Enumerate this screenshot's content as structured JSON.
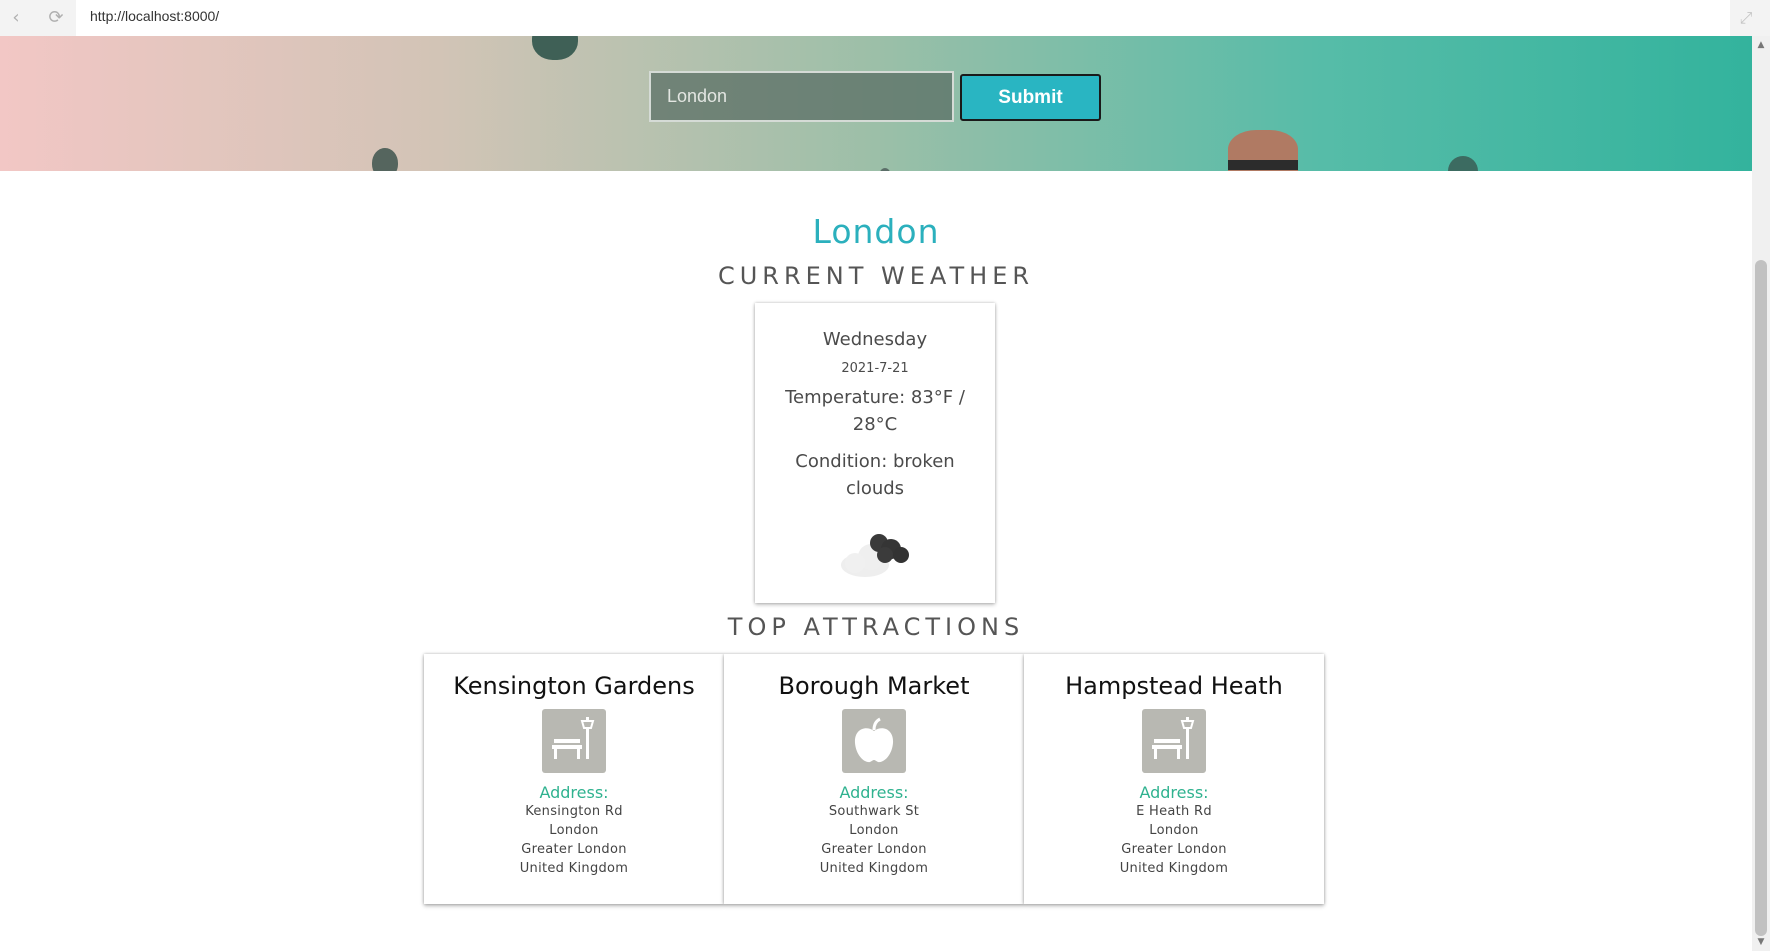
{
  "browser": {
    "url": "http://localhost:8000/",
    "back_icon": "back-arrow-icon",
    "reload_icon": "reload-icon",
    "expand_icon": "expand-icon"
  },
  "search": {
    "placeholder": "London",
    "submit_label": "Submit"
  },
  "weather": {
    "city": "London",
    "section_title": "CURRENT WEATHER",
    "day": "Wednesday",
    "date": "2021-7-21",
    "temperature": "Temperature: 83°F / 28°C",
    "condition": "Condition: broken clouds",
    "icon": "broken-clouds-icon"
  },
  "attractions": {
    "section_title": "TOP ATTRACTIONS",
    "items": [
      {
        "name": "Kensington Gardens",
        "icon": "park-icon",
        "address_label": "Address:",
        "address": [
          "Kensington Rd",
          "London",
          "Greater London",
          "United Kingdom"
        ]
      },
      {
        "name": "Borough Market",
        "icon": "apple-icon",
        "address_label": "Address:",
        "address": [
          "Southwark St",
          "London",
          "Greater London",
          "United Kingdom"
        ]
      },
      {
        "name": "Hampstead Heath",
        "icon": "park-icon",
        "address_label": "Address:",
        "address": [
          "E Heath Rd",
          "London",
          "Greater London",
          "United Kingdom"
        ]
      }
    ]
  },
  "colors": {
    "accent_teal": "#2bb0bd",
    "address_green": "#2fb28f",
    "submit_bg": "#29b5c2"
  }
}
